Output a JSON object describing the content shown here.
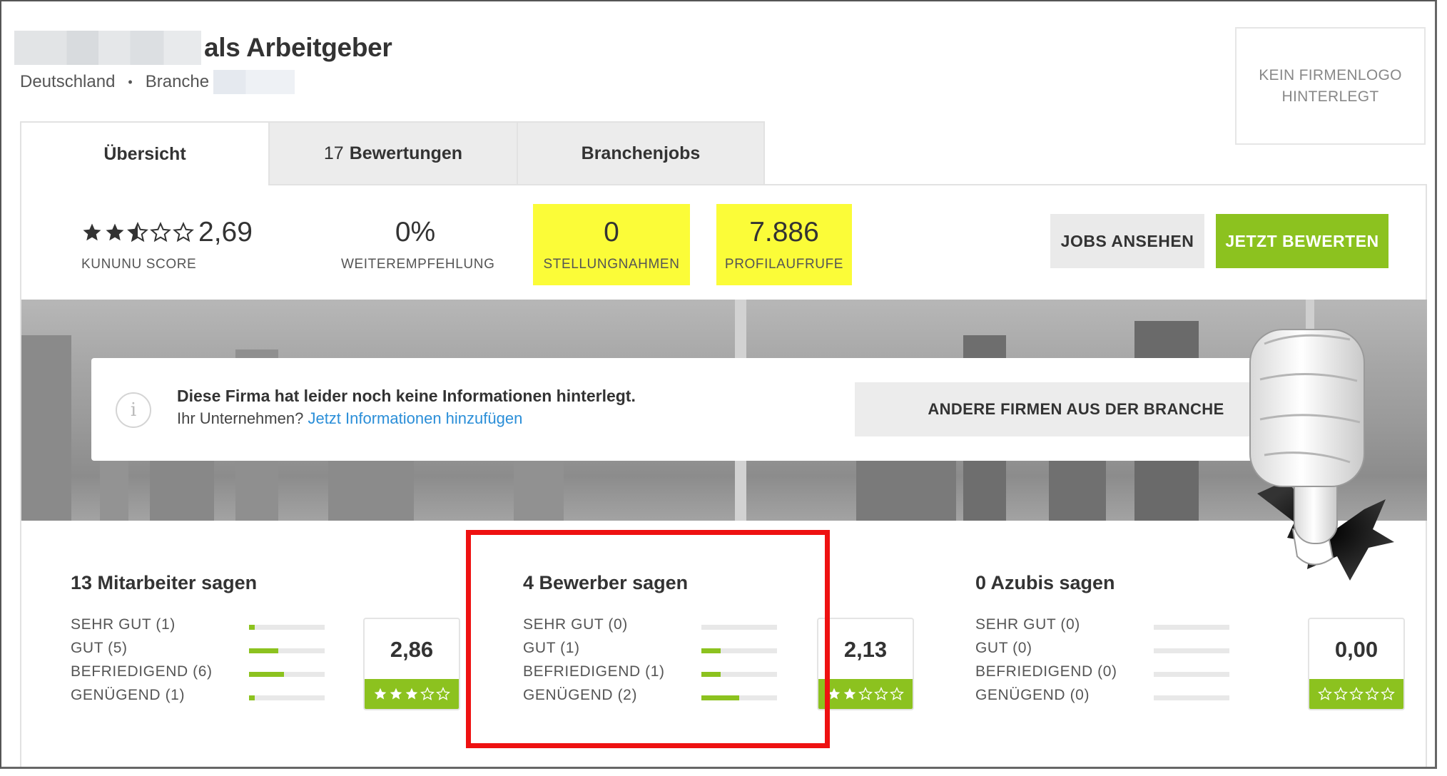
{
  "header": {
    "title_suffix": "als Arbeitgeber",
    "country": "Deutschland",
    "separator": "•",
    "branche_label": "Branche",
    "logo_placeholder_line1": "KEIN FIRMENLOGO",
    "logo_placeholder_line2": "HINTERLEGT"
  },
  "tabs": [
    {
      "label": "Übersicht",
      "count": ""
    },
    {
      "label": "Bewertungen",
      "count": "17"
    },
    {
      "label": "Branchenjobs",
      "count": ""
    }
  ],
  "stats": {
    "score_value": "2,69",
    "score_label": "KUNUNU SCORE",
    "score_stars": 2.69,
    "recommend_value": "0%",
    "recommend_label": "WEITEREMPFEHLUNG",
    "statements_value": "0",
    "statements_label": "STELLUNGNAHMEN",
    "views_value": "7.886",
    "views_label": "PROFILAUFRUFE"
  },
  "buttons": {
    "jobs": "JOBS ANSEHEN",
    "rate": "JETZT BEWERTEN"
  },
  "info": {
    "icon": "i",
    "title": "Diese Firma hat leider noch keine Informationen hinterlegt.",
    "question": "Ihr Unternehmen?",
    "link": "Jetzt Informationen hinzufügen",
    "other_button": "ANDERE FIRMEN AUS DER BRANCHE"
  },
  "groups": [
    {
      "title": "13 Mitarbeiter sagen",
      "score": "2,86",
      "stars": 3,
      "rows": [
        {
          "label": "SEHR GUT (1)",
          "fraction": 0.077
        },
        {
          "label": "GUT (5)",
          "fraction": 0.385
        },
        {
          "label": "BEFRIEDIGEND (6)",
          "fraction": 0.462
        },
        {
          "label": "GENÜGEND (1)",
          "fraction": 0.077
        }
      ]
    },
    {
      "title": "4 Bewerber sagen",
      "score": "2,13",
      "stars": 2,
      "rows": [
        {
          "label": "SEHR GUT (0)",
          "fraction": 0
        },
        {
          "label": "GUT (1)",
          "fraction": 0.25
        },
        {
          "label": "BEFRIEDIGEND (1)",
          "fraction": 0.25
        },
        {
          "label": "GENÜGEND (2)",
          "fraction": 0.5
        }
      ]
    },
    {
      "title": "0 Azubis sagen",
      "score": "0,00",
      "stars": 0,
      "rows": [
        {
          "label": "SEHR GUT (0)",
          "fraction": 0
        },
        {
          "label": "GUT (0)",
          "fraction": 0
        },
        {
          "label": "BEFRIEDIGEND (0)",
          "fraction": 0
        },
        {
          "label": "GENÜGEND (0)",
          "fraction": 0
        }
      ]
    }
  ],
  "colors": {
    "accent_green": "#8cc21f",
    "highlight_yellow": "#fbfc38",
    "annotation_red": "#ee1111",
    "link_blue": "#2a8ed8"
  }
}
